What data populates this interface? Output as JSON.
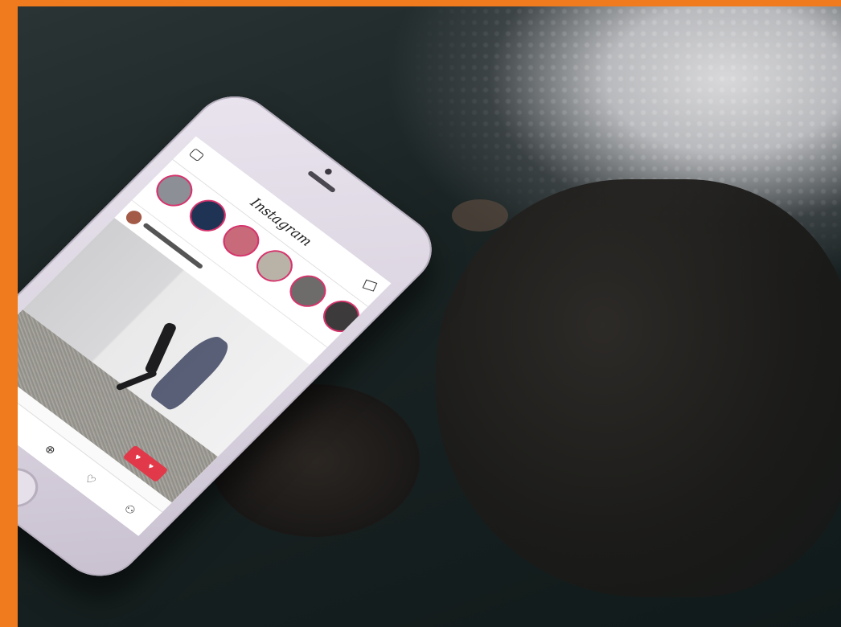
{
  "app": {
    "name": "Instagram"
  },
  "feed": {
    "like_heart": "♥",
    "like_count": "♥"
  },
  "icons": {
    "tab_home": "home-icon",
    "tab_search": "search-icon",
    "tab_add": "add-icon",
    "tab_activity": "heart-icon",
    "tab_profile": "profile-icon"
  },
  "colors": {
    "frame": "#f07a1e",
    "story_ring": "#d6336c",
    "like_badge": "#e2394a"
  }
}
